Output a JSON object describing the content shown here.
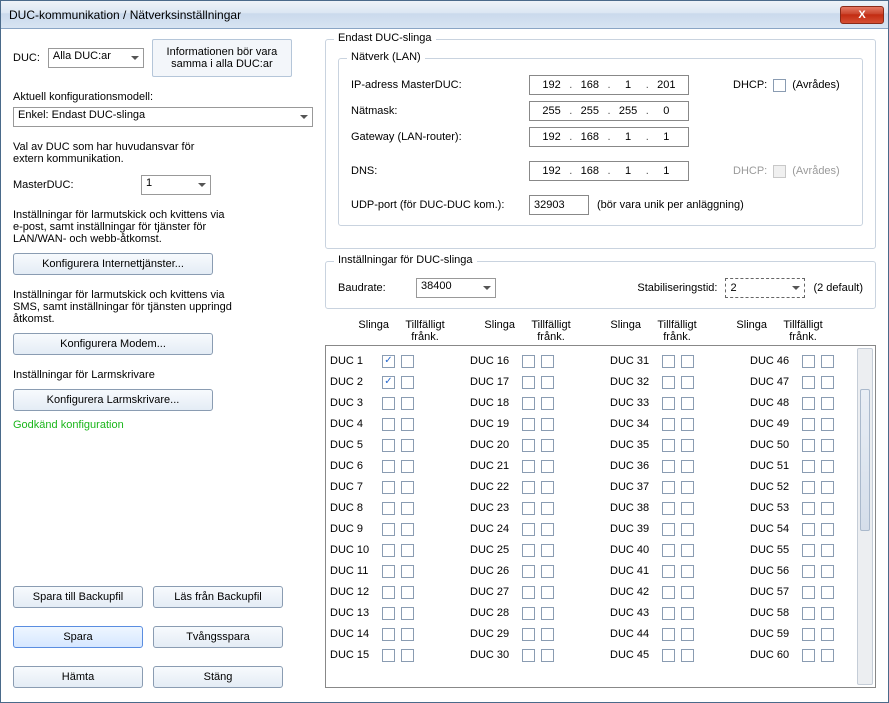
{
  "window": {
    "title": "DUC-kommunikation / Nätverksinställningar"
  },
  "left": {
    "duc_label": "DUC:",
    "duc_select": "Alla DUC:ar",
    "info_line1": "Informationen bör vara",
    "info_line2": "samma i alla DUC:ar",
    "config_model_label": "Aktuell konfigurationsmodell:",
    "config_model_value": "Enkel: Endast DUC-slinga",
    "val_label_line1": "Val av DUC som har huvudansvar för",
    "val_label_line2": "extern kommunikation.",
    "master_label": "MasterDUC:",
    "master_value": "1",
    "inet_line1": "Inställningar för larmutskick och kvittens via",
    "inet_line2": "e-post, samt inställningar för tjänster för",
    "inet_line3": "LAN/WAN- och webb-åtkomst.",
    "inet_btn": "Konfigurera Internettjänster...",
    "modem_line1": "Inställningar för larmutskick och kvittens via",
    "modem_line2": "SMS, samt inställningar för tjänsten uppringd",
    "modem_line3": "åtkomst.",
    "modem_btn": "Konfigurera Modem...",
    "printer_label": "Inställningar för Larmskrivare",
    "printer_btn": "Konfigurera Larmskrivare...",
    "status": "Godkänd konfiguration",
    "btns": {
      "save_backup": "Spara till Backupfil",
      "load_backup": "Läs från Backupfil",
      "save": "Spara",
      "force_save": "Tvångsspara",
      "fetch": "Hämta",
      "close": "Stäng"
    }
  },
  "right": {
    "main_group": "Endast DUC-slinga",
    "lan_group": "Nätverk (LAN)",
    "ip_label": "IP-adress MasterDUC:",
    "netmask_label": "Nätmask:",
    "gateway_label": "Gateway (LAN-router):",
    "dns_label": "DNS:",
    "dhcp_label": "DHCP:",
    "dhcp_text": "(Avrådes)",
    "udp_label": "UDP-port (för DUC-DUC kom.):",
    "udp_value": "32903",
    "udp_hint": "(bör vara unik per anläggning)",
    "ip": [
      "192",
      "168",
      "1",
      "201"
    ],
    "netmask": [
      "255",
      "255",
      "255",
      "0"
    ],
    "gateway": [
      "192",
      "168",
      "1",
      "1"
    ],
    "dns": [
      "192",
      "168",
      "1",
      "1"
    ],
    "slinga_group": "Inställningar för DUC-slinga",
    "baud_label": "Baudrate:",
    "baud_value": "38400",
    "stab_label": "Stabiliseringstid:",
    "stab_value": "2",
    "stab_hint": "(2 default)",
    "col_header_slinga": "Slinga",
    "col_header_tillf": "Tillfälligt frånk.",
    "duc_loop": {
      "checked_loop": [
        1,
        2
      ]
    }
  }
}
